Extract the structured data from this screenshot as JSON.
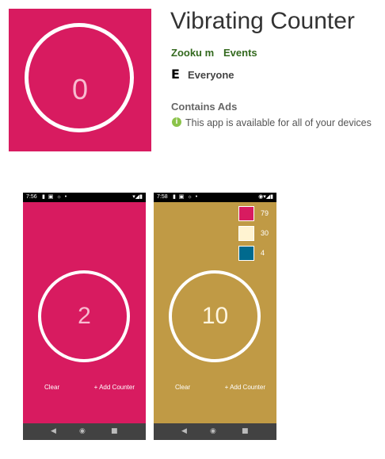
{
  "app": {
    "title": "Vibrating Counter",
    "developer": "Zooku m",
    "category": "Events",
    "rating_label": "Everyone",
    "ads_label": "Contains Ads",
    "availability": "This app is available for all of your devices",
    "rating_icon_char": "E",
    "info_icon_char": "i"
  },
  "icon": {
    "count": "0",
    "color": "#d81b60"
  },
  "screenshots": [
    {
      "time": "7:56",
      "status_icons": "▮ ▣ ☼ •",
      "signal": "▾◢▮",
      "count": "2",
      "clear_label": "Clear",
      "add_label": "+ Add Counter",
      "bg": "#d81b60"
    },
    {
      "time": "7:58",
      "status_icons": "▮ ▣ ☼ •",
      "signal": "◉▾◢▮",
      "count": "10",
      "clear_label": "Clear",
      "add_label": "+ Add Counter",
      "bg": "#c09a45",
      "counters": [
        {
          "color": "#d81b60",
          "value": "79"
        },
        {
          "color": "#fff3d1",
          "value": "30"
        },
        {
          "color": "#006a8e",
          "value": "4"
        }
      ]
    }
  ],
  "nav": {
    "back": "◀",
    "home": "◉",
    "recent": "■"
  }
}
